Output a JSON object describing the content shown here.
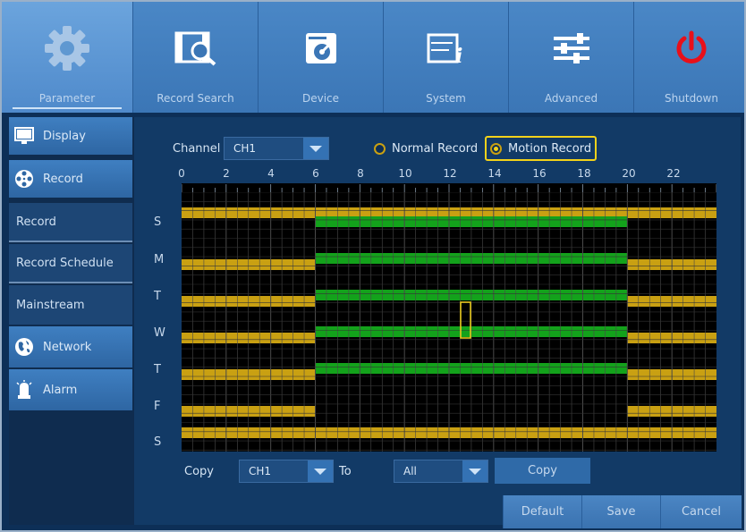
{
  "nav": {
    "parameter": "Parameter",
    "record_search": "Record Search",
    "device": "Device",
    "system": "System",
    "advanced": "Advanced",
    "shutdown": "Shutdown"
  },
  "sidebar": {
    "display": "Display",
    "record": "Record",
    "record_sub": "Record",
    "record_schedule": "Record Schedule",
    "mainstream": "Mainstream",
    "network": "Network",
    "alarm": "Alarm"
  },
  "schedule": {
    "channel_label": "Channel",
    "channel_value": "CH1",
    "normal_record": "Normal Record",
    "motion_record": "Motion Record",
    "hour_labels": [
      "0",
      "2",
      "4",
      "6",
      "8",
      "10",
      "12",
      "14",
      "16",
      "18",
      "20",
      "22"
    ],
    "days": [
      "S",
      "M",
      "T",
      "W",
      "T",
      "F",
      "S"
    ],
    "colors": {
      "normal": "#c9a012",
      "motion": "#13a21b",
      "cursor": "#f3d21a"
    }
  },
  "copy": {
    "copy_label": "Copy",
    "from_value": "CH1",
    "to_label": "To",
    "to_value": "All",
    "copy_button": "Copy"
  },
  "buttons": {
    "default": "Default",
    "save": "Save",
    "cancel": "Cancel"
  }
}
